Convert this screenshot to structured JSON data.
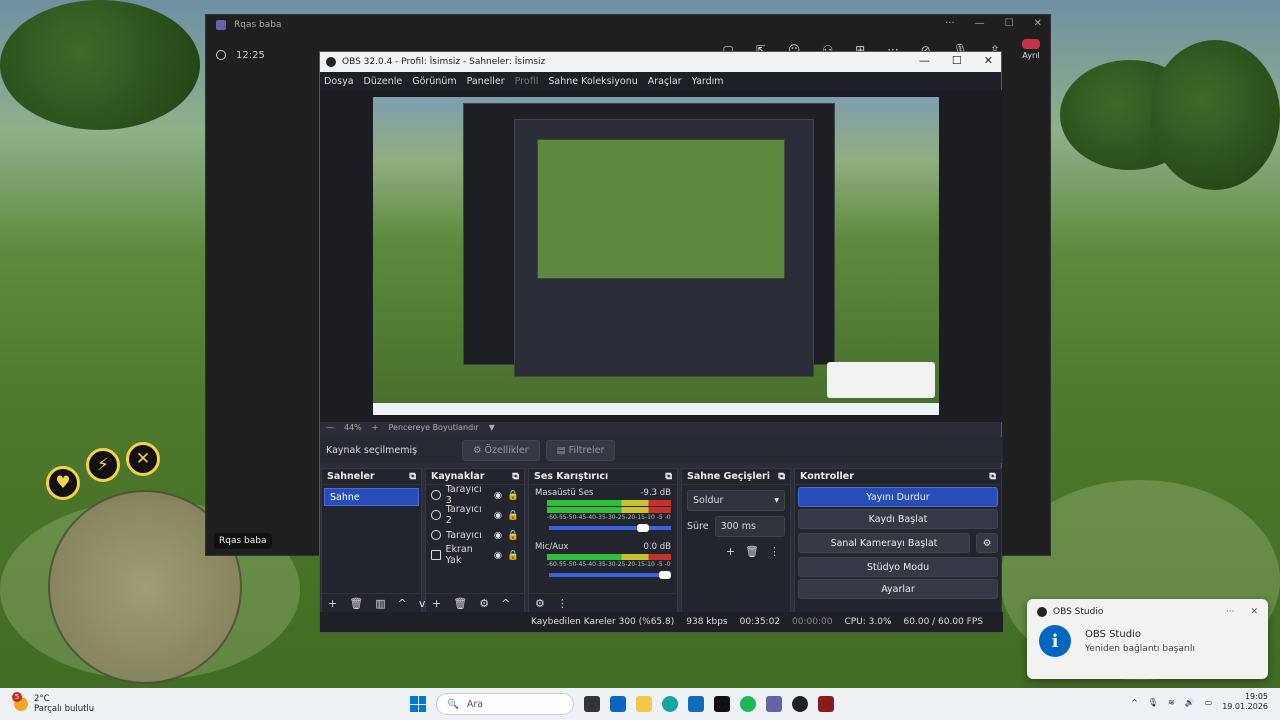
{
  "teams": {
    "title": "Rqas baba",
    "time": "12:25",
    "leave_label": "Ayrıl",
    "participant_label": "Rqas baba"
  },
  "obs": {
    "title": "OBS 32.0.4 - Profil: İsimsiz - Sahneler: İsimsiz",
    "menu": [
      "Dosya",
      "Düzenle",
      "Görünüm",
      "Paneller",
      "Profil",
      "Sahne Koleksiyonu",
      "Araçlar",
      "Yardım"
    ],
    "zoom": "44%",
    "zoom_mode": "Pencereye Boyutlandır",
    "no_source": "Kaynak seçilmemiş",
    "properties_btn": "Özellikler",
    "filters_btn": "Filtreler",
    "docks": {
      "scenes": {
        "title": "Sahneler",
        "items": [
          "Sahne"
        ]
      },
      "sources": {
        "title": "Kaynaklar",
        "items": [
          "Tarayıcı 3",
          "Tarayıcı 2",
          "Tarayıcı",
          "Ekran Yak"
        ]
      },
      "mixer": {
        "title": "Ses Karıştırıcı",
        "channels": [
          {
            "name": "Masaüstü Ses",
            "db": "-9.3 dB",
            "level": 0.72
          },
          {
            "name": "Mic/Aux",
            "db": "0.0 dB",
            "level": 1.0
          }
        ],
        "ticks": "-60-55-50-45-40-35-30-25-20-15-10 -5 -0"
      },
      "transitions": {
        "title": "Sahne Geçişleri",
        "type": "Soldur",
        "duration_label": "Süre",
        "duration": "300 ms"
      },
      "controls": {
        "title": "Kontroller",
        "stop_stream": "Yayını Durdur",
        "start_record": "Kaydı Başlat",
        "virtual_cam": "Sanal Kamerayı Başlat",
        "studio": "Stüdyo Modu",
        "settings": "Ayarlar"
      }
    },
    "status": {
      "dropped": "Kaybedilen Kareler 300 (%65.8)",
      "bitrate": "938 kbps",
      "stream_time": "00:35:02",
      "rec_time": "00:00:00",
      "cpu": "CPU: 3.0%",
      "fps": "60.00 / 60.00 FPS"
    }
  },
  "notification": {
    "app": "OBS Studio",
    "title": "OBS Studio",
    "body": "Yeniden bağlantı başarılı"
  },
  "taskbar": {
    "temp": "2°C",
    "weather": "Parçalı bulutlu",
    "weather_badge": "5",
    "search_placeholder": "Ara",
    "time": "19:05",
    "date": "19.01.2026"
  },
  "colors": {
    "accent": "#284cb8",
    "obs_bg": "#2b2e38",
    "taskbar": "#eef2f6"
  }
}
